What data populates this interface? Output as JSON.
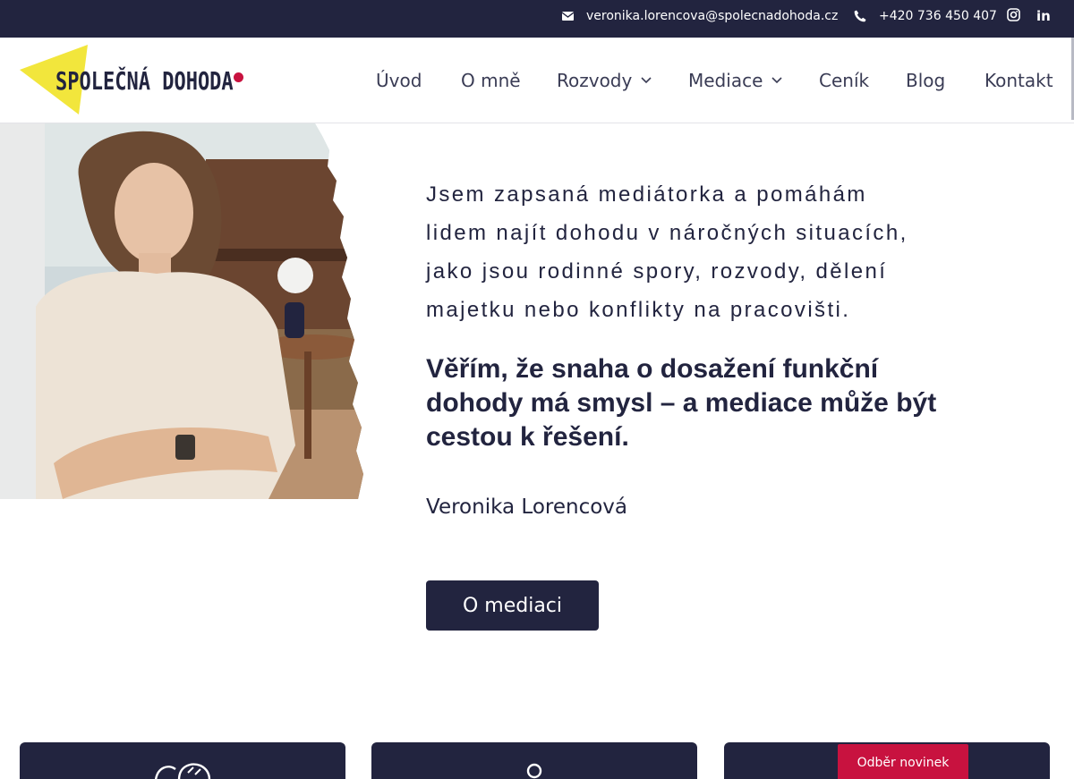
{
  "topbar": {
    "email": "veronika.lorencova@spolecnadohoda.cz",
    "phone": "+420 736 450 407",
    "instagram_icon": "instagram-icon",
    "linkedin_label": "in"
  },
  "header": {
    "logo_text": "SPOLEČNÁ DOHODA",
    "nav": [
      {
        "label": "Úvod"
      },
      {
        "label": "O mně"
      },
      {
        "label": "Rozvody",
        "dropdown": true
      },
      {
        "label": "Mediace",
        "dropdown": true
      },
      {
        "label": "Ceník"
      },
      {
        "label": "Blog"
      },
      {
        "label": "Kontakt"
      }
    ]
  },
  "hero": {
    "intro_lines": [
      "Jsem zapsaná mediátorka a pomáhám",
      "lidem najít dohodu v náročných situacích,",
      "jako jsou rodinné spory, rozvody, dělení",
      "majetku nebo konflikty na pracovišti."
    ],
    "quote": "Věřím, že snaha o dosažení funkční dohody má smysl – a mediace může být cestou k řešení.",
    "signature": "Veronika Lorencová",
    "cta_label": "O mediaci"
  },
  "newsletter_label": "Odběr novinek",
  "colors": {
    "navy": "#22243f",
    "accent_yellow": "#f2e63c",
    "accent_red": "#c8123f",
    "white": "#ffffff"
  },
  "icons": [
    "email-icon",
    "phone-icon",
    "instagram-icon",
    "linkedin-icon",
    "chevron-down-icon",
    "hands-icon",
    "person-icon"
  ]
}
